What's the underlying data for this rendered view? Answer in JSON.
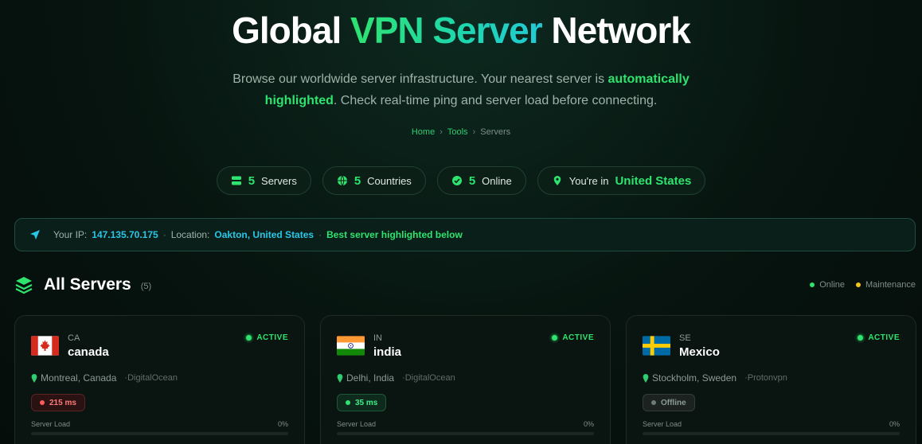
{
  "hero": {
    "title_before": "Global ",
    "title_accent": "VPN Server",
    "title_after": " Network",
    "subtitle_1": "Browse our worldwide server infrastructure. Your nearest server is ",
    "subtitle_hl": "automatically highlighted",
    "subtitle_2": ". Check real-time ping and server load before connecting."
  },
  "breadcrumb": {
    "home": "Home",
    "tools": "Tools",
    "current": "Servers"
  },
  "stats": {
    "servers_num": "5",
    "servers_label": "Servers",
    "countries_num": "5",
    "countries_label": "Countries",
    "online_num": "5",
    "online_label": "Online",
    "location_label": "You're in",
    "location_value": "United States"
  },
  "ipbar": {
    "ip_label": "Your IP:",
    "ip_value": "147.135.70.175",
    "location_label": "Location:",
    "location_value": "Oakton, United States",
    "best_text": "Best server highlighted below"
  },
  "section": {
    "title": "All Servers",
    "count": "(5)",
    "legend_online": "Online",
    "legend_maintenance": "Maintenance"
  },
  "colors": {
    "accent": "#2ee36e",
    "cyan": "#29c6e6",
    "danger": "#ff5c5c",
    "maintenance": "#f5c518"
  },
  "servers": [
    {
      "code": "CA",
      "name": "canada",
      "status": "ACTIVE",
      "city": "Montreal, Canada",
      "provider": "DigitalOcean",
      "ping": "215 ms",
      "ping_state": "red",
      "load_label": "Server Load",
      "load_value": "0%",
      "load_fraction": 0,
      "flag": "canada-flag-icon"
    },
    {
      "code": "IN",
      "name": "india",
      "status": "ACTIVE",
      "city": "Delhi, India",
      "provider": "DigitalOcean",
      "ping": "35 ms",
      "ping_state": "green",
      "load_label": "Server Load",
      "load_value": "0%",
      "load_fraction": 0,
      "flag": "india-flag-icon"
    },
    {
      "code": "SE",
      "name": "Mexico",
      "status": "ACTIVE",
      "city": "Stockholm, Sweden",
      "provider": "Protonvpn",
      "ping": "Offline",
      "ping_state": "gray",
      "load_label": "Server Load",
      "load_value": "0%",
      "load_fraction": 0,
      "flag": "sweden-flag-icon"
    }
  ]
}
